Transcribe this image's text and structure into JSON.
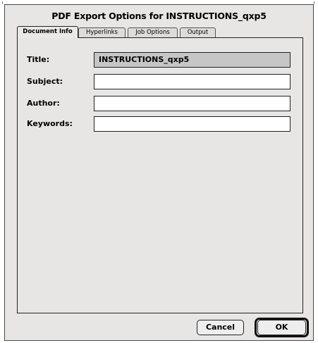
{
  "dialog": {
    "title": "PDF Export Options for INSTRUCTIONS_qxp5"
  },
  "tabs": [
    {
      "label": "Document Info",
      "active": true
    },
    {
      "label": "Hyperlinks",
      "active": false
    },
    {
      "label": "Job Options",
      "active": false
    },
    {
      "label": "Output",
      "active": false
    }
  ],
  "fields": {
    "title": {
      "label": "Title:",
      "value": "INSTRUCTIONS_qxp5"
    },
    "subject": {
      "label": "Subject:",
      "value": ""
    },
    "author": {
      "label": "Author:",
      "value": ""
    },
    "keywords": {
      "label": "Keywords:",
      "value": ""
    }
  },
  "buttons": {
    "cancel": "Cancel",
    "ok": "OK"
  }
}
